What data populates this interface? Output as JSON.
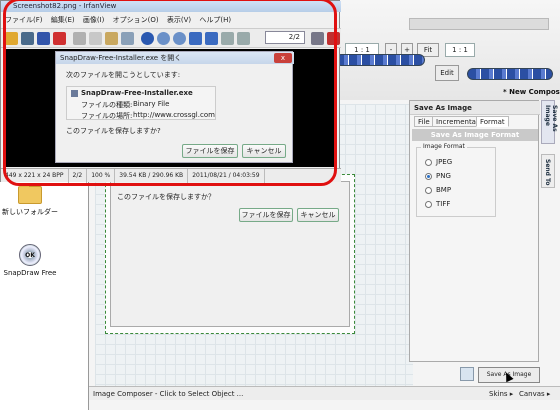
{
  "desktop": {
    "items": [
      {
        "label": "新しいフォルダー"
      },
      {
        "label": "SnapDraw Free",
        "icon_text": "OK"
      }
    ]
  },
  "snapdraw": {
    "zoom": "1 : 1",
    "zoom_minus": "-",
    "zoom_plus": "+",
    "fit": "Fit",
    "zoom_right": "1 : 1",
    "edit": "Edit",
    "new_composition": "* New Composition",
    "panel": {
      "title": "Save As Image",
      "tabs": [
        "File",
        "Incremental",
        "Format"
      ],
      "header": "Save As Image Format",
      "format_group": "Image Format",
      "formats": [
        "JPEG",
        "PNG",
        "BMP",
        "TIFF"
      ],
      "selected": "PNG",
      "save_button": "Save As Image"
    },
    "side_tabs": [
      "Save As Image",
      "Send To"
    ],
    "status": {
      "left": "Image Composer - Click to Select Object ...",
      "skins": "Skins ▸",
      "canvas": "Canvas ▸"
    },
    "canvas_dialog": {
      "question": "このファイルを保存しますか？",
      "save": "ファイルを保存",
      "cancel": "キャンセル"
    }
  },
  "irfanview": {
    "title": "Screenshot82.png - IrfanView",
    "menu": [
      "ファイル(F)",
      "編集(E)",
      "画像(I)",
      "オプション(O)",
      "表示(V)",
      "ヘルプ(H)"
    ],
    "page": "2/2",
    "status": [
      "449 x 221 x 24 BPP",
      "2/2",
      "100 %",
      "39.54 KB / 290.96 KB",
      "2011/08/21 / 04:03:59"
    ]
  },
  "dialog": {
    "title": "SnapDraw-Free-Installer.exe を開く",
    "intro": "次のファイルを開こうとしています:",
    "filename": "SnapDraw-Free-Installer.exe",
    "type_label": "ファイルの種類:",
    "type_value": "Binary File",
    "source_label": "ファイルの場所:",
    "source_value": "http://www.crossgl.com",
    "question": "このファイルを保存しますか?",
    "save": "ファイルを保存",
    "cancel": "キャンセル",
    "close": "x"
  },
  "colors": {
    "highlight": "#e01010",
    "accent": "#2a6fc4"
  }
}
